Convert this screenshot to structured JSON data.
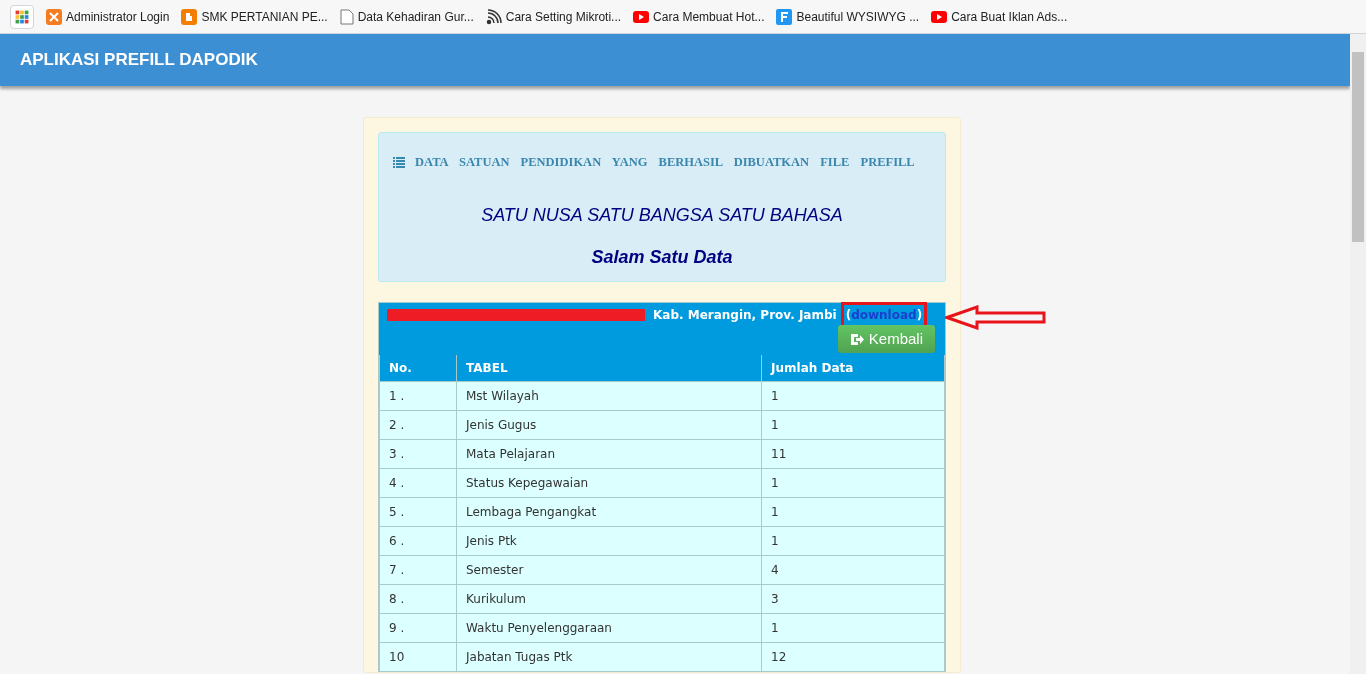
{
  "bookmarks": [
    {
      "kind": "apps"
    },
    {
      "kind": "xampp",
      "label": "Administrator Login"
    },
    {
      "kind": "blogger",
      "label": "SMK PERTANIAN PE..."
    },
    {
      "kind": "page",
      "label": "Data Kehadiran Gur..."
    },
    {
      "kind": "rss",
      "label": "Cara Setting Mikroti..."
    },
    {
      "kind": "youtube",
      "label": "Cara Membuat Hot..."
    },
    {
      "kind": "f",
      "label": "Beautiful WYSIWYG ..."
    },
    {
      "kind": "youtube",
      "label": "Cara Buat Iklan Ads..."
    }
  ],
  "navbar": {
    "title": "APLIKASI PREFILL DAPODIK"
  },
  "info_box": {
    "heading": "DATA SATUAN PENDIDIKAN YANG BERHASIL DIBUATKAN FILE PREFILL",
    "motto": "SATU NUSA SATU BANGSA SATU BAHASA",
    "greeting": "Salam Satu Data"
  },
  "result": {
    "location": "Kab. Merangin, Prov. Jambi",
    "before": "(",
    "link": "download",
    "after": ")",
    "button": "Kembali"
  },
  "table": {
    "columns": [
      "No.",
      "TABEL",
      "Jumlah Data"
    ],
    "rows": [
      [
        "1 .",
        "Mst Wilayah",
        "1"
      ],
      [
        "2 .",
        "Jenis Gugus",
        "1"
      ],
      [
        "3 .",
        "Mata Pelajaran",
        "11"
      ],
      [
        "4 .",
        "Status Kepegawaian",
        "1"
      ],
      [
        "5 .",
        "Lembaga Pengangkat",
        "1"
      ],
      [
        "6 .",
        "Jenis Ptk",
        "1"
      ],
      [
        "7 .",
        "Semester",
        "4"
      ],
      [
        "8 .",
        "Kurikulum",
        "3"
      ],
      [
        "9 .",
        "Waktu Penyelenggaraan",
        "1"
      ],
      [
        "10",
        "Jabatan Tugas Ptk",
        "12"
      ]
    ]
  }
}
